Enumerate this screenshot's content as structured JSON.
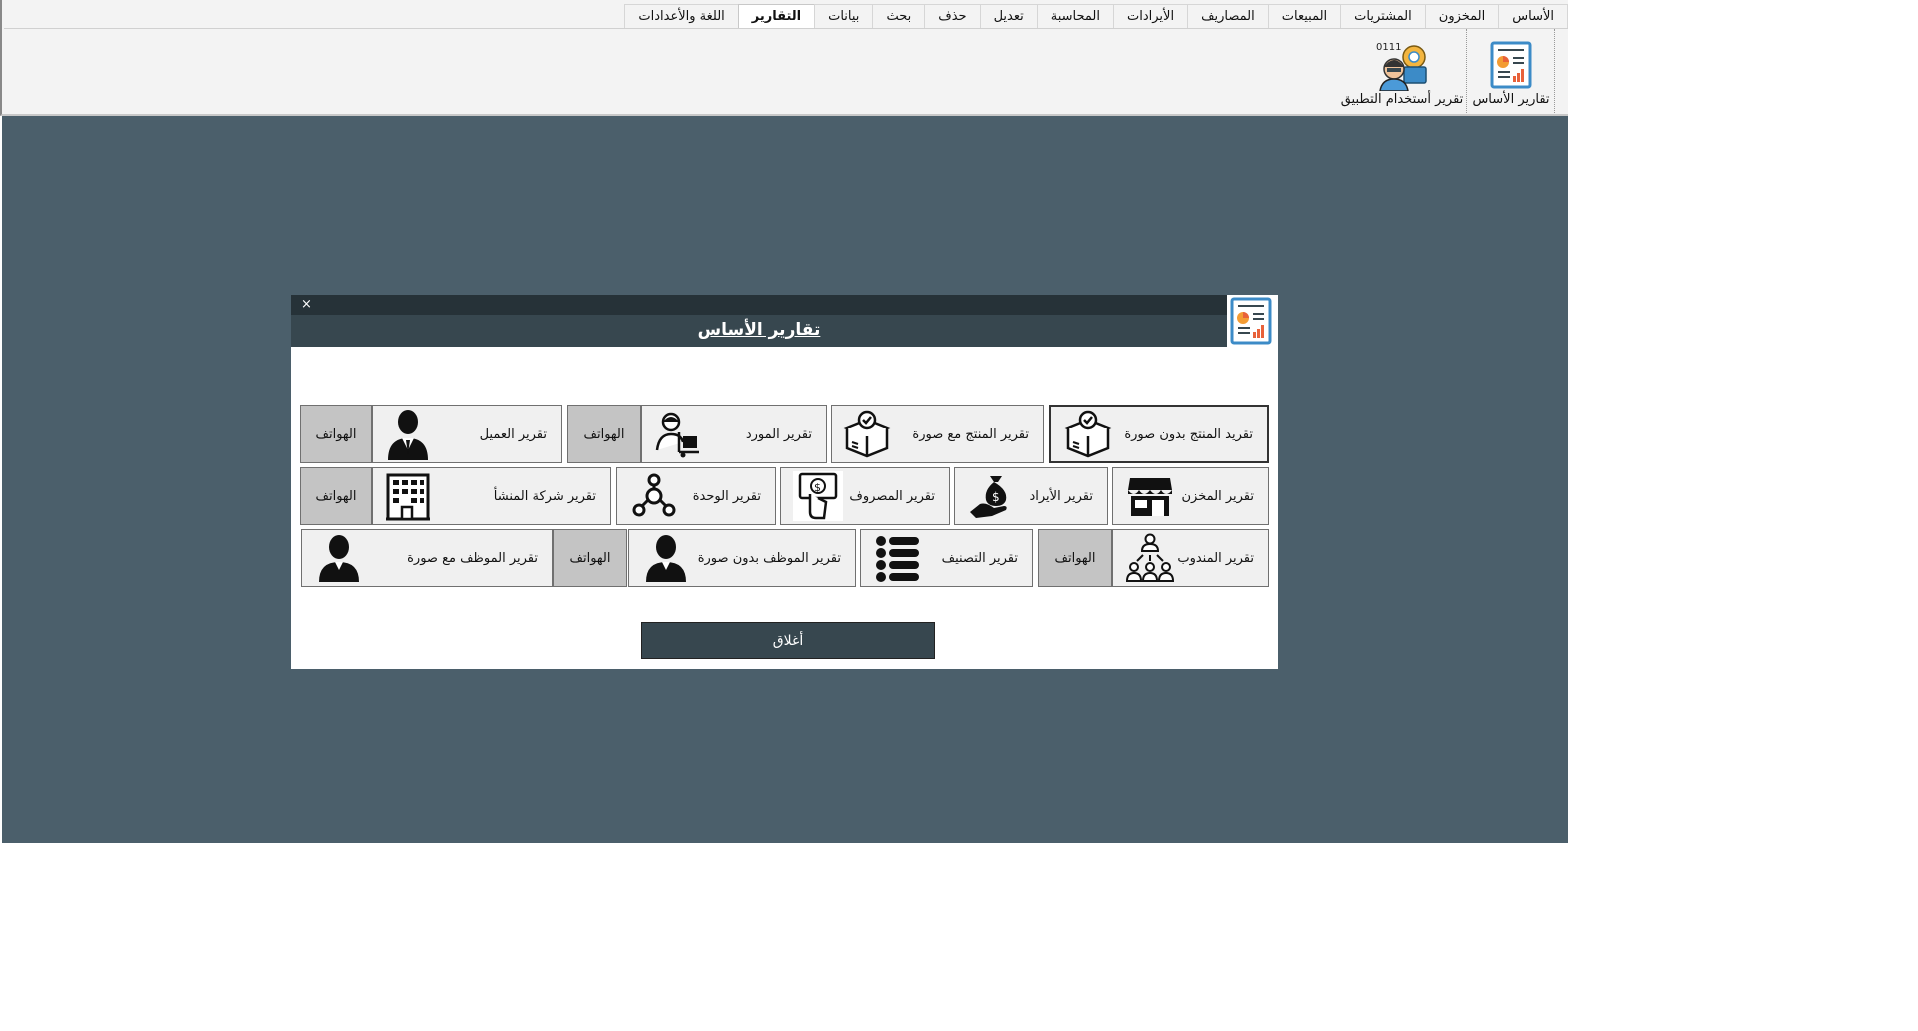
{
  "ribbon": {
    "tabs": [
      {
        "label": "الأساس"
      },
      {
        "label": "المخزون"
      },
      {
        "label": "المشتريات"
      },
      {
        "label": "المبيعات"
      },
      {
        "label": "المصاريف"
      },
      {
        "label": "الأيرادات"
      },
      {
        "label": "المحاسبة"
      },
      {
        "label": "تعديل"
      },
      {
        "label": "حذف"
      },
      {
        "label": "بحث"
      },
      {
        "label": "بيانات"
      },
      {
        "label": "التقارير"
      },
      {
        "label": "اللغة والأعدادات"
      }
    ],
    "active_tab": "التقارير",
    "buttons": [
      {
        "label": "تقارير الأساس",
        "icon": "report-icon"
      },
      {
        "label": "تقرير أستخدام التطبيق",
        "icon": "developer-icon",
        "badge": "0111"
      }
    ]
  },
  "dialog": {
    "title": "تقارير الأساس",
    "close_symbol": "×",
    "close_button": "أغلاق",
    "phones_label": "الهواتف",
    "buttons": {
      "product_no_image": "تقريد المنتج بدون صورة",
      "product_with_image": "تقرير المنتج مع صورة",
      "supplier": "تقرير المورد",
      "customer": "تقرير العميل",
      "warehouse": "تقرير المخزن",
      "revenue": "تقرير الأيراد",
      "expense": "تقرير المصروف",
      "unit": "تقرير الوحدة",
      "company": "تقرير شركة المنشأ",
      "agent": "تقرير المندوب",
      "category": "تقرير التصنيف",
      "employee_no_image": "تقرير الموظف بدون صورة",
      "employee_with_image": "تقرير الموظف مع صورة"
    }
  },
  "colors": {
    "workspace": "#4b5f6b",
    "dialog_header": "#37474f",
    "dialog_titlestrip": "#263238",
    "phones_button": "#c4c4c4",
    "report_button": "#f0f0f0"
  }
}
